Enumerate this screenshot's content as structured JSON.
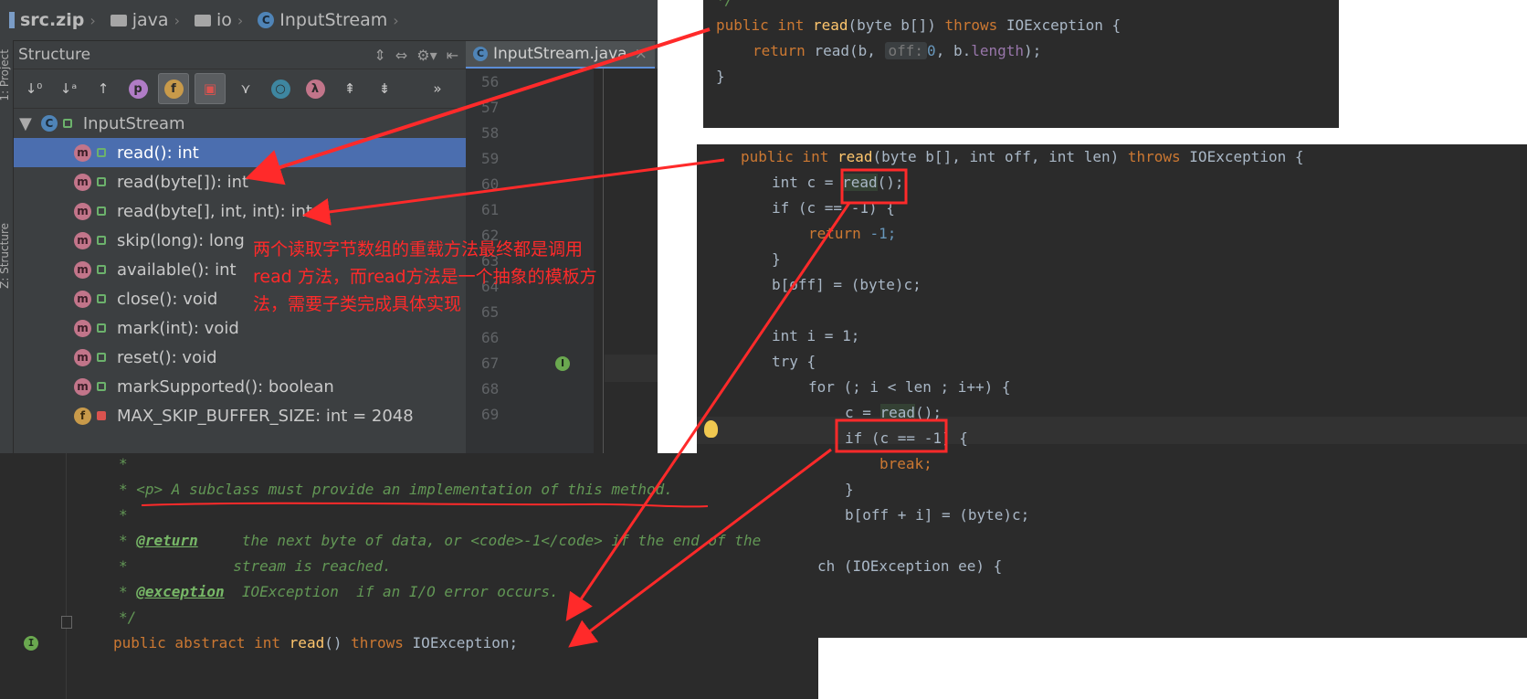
{
  "breadcrumb": {
    "root": "src.zip",
    "folder1": "java",
    "folder2": "io",
    "class": "InputStream"
  },
  "sidebar": {
    "strip_label": "1: Project",
    "strip_label2": "Z: Structure"
  },
  "structure": {
    "title": "Structure",
    "toolbar_more": "»",
    "root_label": "InputStream",
    "items": [
      {
        "label": "read(): int",
        "kind": "m",
        "selected": true
      },
      {
        "label": "read(byte[]): int",
        "kind": "m"
      },
      {
        "label": "read(byte[], int, int): int",
        "kind": "m"
      },
      {
        "label": "skip(long): long",
        "kind": "m"
      },
      {
        "label": "available(): int",
        "kind": "m"
      },
      {
        "label": "close(): void",
        "kind": "m"
      },
      {
        "label": "mark(int): void",
        "kind": "m"
      },
      {
        "label": "reset(): void",
        "kind": "m"
      },
      {
        "label": "markSupported(): boolean",
        "kind": "m"
      },
      {
        "label": "MAX_SKIP_BUFFER_SIZE: int = 2048",
        "kind": "f"
      }
    ]
  },
  "editor": {
    "tab_label": "InputStream.java",
    "line_numbers": [
      "56",
      "57",
      "58",
      "59",
      "60",
      "61",
      "62",
      "63",
      "64",
      "65",
      "66",
      "67",
      "68",
      "69"
    ],
    "visible_token": "p"
  },
  "code_a": {
    "l0": "*/",
    "l1_kw1": "public int",
    "l1_fn": "read",
    "l1_args": "(byte b[])",
    "l1_kw2": "throws",
    "l1_rest": "IOException {",
    "l2_kw": "return",
    "l2_call": "read(b,",
    "l2_hint": "off:",
    "l2_num": "0",
    "l2_mid": ", b.",
    "l2_fld": "length",
    "l2_end": ");",
    "l3": "}"
  },
  "code_b": {
    "l1_kw1": "public int",
    "l1_fn": "read",
    "l1_args": "(byte b[], int off, int len)",
    "l1_kw2": "throws",
    "l1_rest": "IOException {",
    "l2_pre": "int c = ",
    "l2_call": "read",
    "l2_post": "();",
    "l3": "if (c == -1) {",
    "l4_kw": "return",
    "l4_num": "-1;",
    "l5": "}",
    "l6": "b[off] = (byte)c;",
    "l8": "int i = 1;",
    "l9": "try {",
    "l10": "for (; i < len ; i++) {",
    "l11_pre": "c = ",
    "l11_call": "read",
    "l11_post": "();",
    "l12": "if (c == -1) {",
    "l13": "break;",
    "l14": "}",
    "l15": "b[off + i] = (byte)c;",
    "l17": "ch (IOException ee) {"
  },
  "code_c": {
    "c1": "*",
    "c2": "* <p> A subclass must provide an implementation of this method.",
    "c3": "*",
    "c4_pre": "* ",
    "c4_tag": "@return",
    "c4_text": "     the next byte of data, or <code>-1</code> if the end of the",
    "c5": "*            stream is reached.",
    "c6_pre": "* ",
    "c6_tag": "@exception",
    "c6_text": "  IOException  if an I/O error occurs.",
    "c7": "*/",
    "c8_kw1": "public abstract int",
    "c8_fn": "read",
    "c8_post": "()",
    "c8_kw2": "throws",
    "c8_rest": "IOException;"
  },
  "annotation": {
    "line1": "两个读取字节数组的重载方法最终都是调用",
    "line2": "read 方法，而read方法是一个抽象的模板方",
    "line3": "法，需要子类完成具体实现",
    "color": "#ff2a2a"
  },
  "colors": {
    "ide_bg": "#3c3f41",
    "editor_bg": "#2b2b2b",
    "selection": "#4b6eaf",
    "keyword": "#cc7832",
    "method": "#ffc66d",
    "comment": "#629755",
    "arrow": "#ff2a2a"
  }
}
